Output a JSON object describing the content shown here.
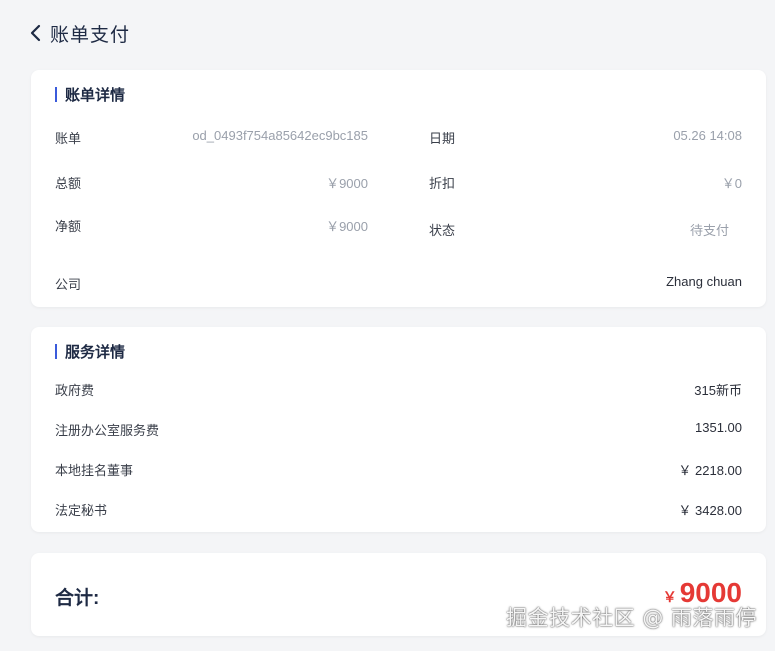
{
  "header": {
    "title": "账单支付"
  },
  "bill": {
    "title": "账单详情",
    "rows": [
      {
        "label": "账单",
        "value": "od_0493f754a85642ec9bc185"
      },
      {
        "label": "日期",
        "value": "05.26 14:08"
      },
      {
        "label": "总额",
        "value": "￥9000"
      },
      {
        "label": "折扣",
        "value": "￥0"
      },
      {
        "label": "净额",
        "value": "￥9000"
      },
      {
        "label": "状态",
        "value": "待支付"
      },
      {
        "label": "公司",
        "value": "Zhang chuan"
      }
    ]
  },
  "service": {
    "title": "服务详情",
    "items": [
      {
        "label": "政府费",
        "value": "315新币"
      },
      {
        "label": "注册办公室服务费",
        "value": "1351.00"
      },
      {
        "label": "本地挂名董事",
        "value": "￥ 2218.00"
      },
      {
        "label": "法定秘书",
        "value": "￥ 3428.00"
      }
    ]
  },
  "total": {
    "label": "合计:",
    "currency": "￥",
    "amount": "9000"
  },
  "watermark": "掘金技术社区 @ 雨落雨停",
  "colors": {
    "accent": "#3b5bdb",
    "price": "#e53935",
    "background": "#f4f5f7"
  }
}
